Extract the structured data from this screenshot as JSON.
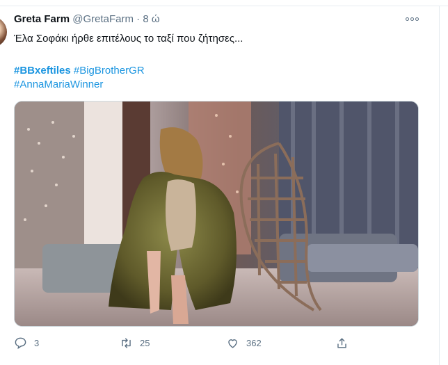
{
  "tweet": {
    "author_name": "Greta Farm",
    "handle": "@GretaFarm",
    "separator": "·",
    "time": "8 ώ",
    "text": "Έλα Σοφάκι ήρθε επιτέλους το ταξί που ζήτησες...",
    "hashtags": [
      "#BBxeftiles",
      "#BigBrotherGR",
      "#AnnaMariaWinner"
    ]
  },
  "actions": {
    "replies": "3",
    "retweets": "25",
    "likes": "362"
  },
  "icons": {
    "more": "more-horizontal-icon",
    "reply": "reply-icon",
    "retweet": "retweet-icon",
    "like": "heart-icon",
    "share": "share-icon"
  },
  "colors": {
    "link": "#1b95e0",
    "secondary_text": "#5b7083",
    "primary_text": "#0f1419"
  }
}
